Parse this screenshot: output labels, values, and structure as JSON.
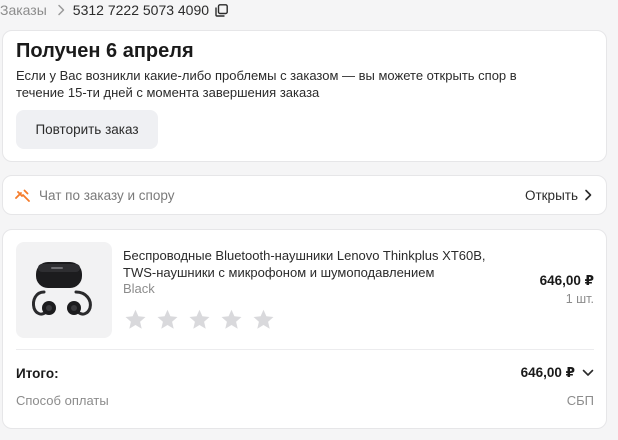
{
  "breadcrumb": {
    "root": "Заказы",
    "order_number": "5312 7222 5073 4090"
  },
  "status": {
    "title": "Получен 6 апреля",
    "description": "Если у Вас возникли какие-либо проблемы с заказом — вы можете открыть спор в течение 15-ти дней с момента завершения заказа",
    "repeat_label": "Повторить заказ"
  },
  "chat": {
    "label": "Чат по заказу и спору",
    "open_label": "Открыть",
    "icon_color": "#f57c2b"
  },
  "product": {
    "title": "Беспроводные Bluetooth-наушники Lenovo Thinkplus XT60B, TWS-наушники с микрофоном и шумоподавлением",
    "variant": "Black",
    "price": "646,00 ₽",
    "quantity": "1 шт.",
    "rating": 0,
    "rating_max": 5,
    "star_color": "#d9d9dc"
  },
  "summary": {
    "total_label": "Итого:",
    "total_value": "646,00 ₽",
    "payment_label": "Способ оплаты",
    "payment_value": "СБП"
  }
}
